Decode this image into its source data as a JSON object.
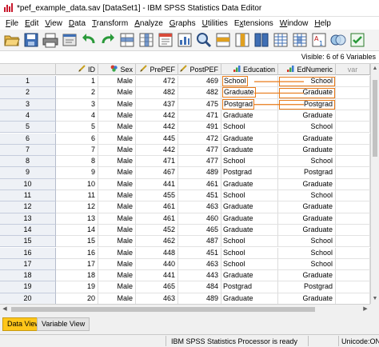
{
  "window": {
    "title": "*pef_example_data.sav [DataSet1] - IBM SPSS Statistics Data Editor"
  },
  "menu": [
    {
      "label": "File",
      "key": "F"
    },
    {
      "label": "Edit",
      "key": "E"
    },
    {
      "label": "View",
      "key": "V"
    },
    {
      "label": "Data",
      "key": "D"
    },
    {
      "label": "Transform",
      "key": "T"
    },
    {
      "label": "Analyze",
      "key": "A"
    },
    {
      "label": "Graphs",
      "key": "G"
    },
    {
      "label": "Utilities",
      "key": "U"
    },
    {
      "label": "Extensions",
      "key": "x"
    },
    {
      "label": "Window",
      "key": "W"
    },
    {
      "label": "Help",
      "key": "H"
    }
  ],
  "toolbar_icons": [
    "open-folder-icon",
    "save-icon",
    "print-icon",
    "dialog-recall-icon",
    "undo-icon",
    "redo-icon",
    "go-to-case-icon",
    "go-to-variable-icon",
    "variables-icon",
    "run-descriptives-icon",
    "find-icon",
    "insert-cases-icon",
    "insert-variable-icon",
    "split-file-icon",
    "weight-cases-icon",
    "select-cases-icon",
    "value-labels-icon",
    "use-variable-sets-icon",
    "spelling-icon"
  ],
  "info": {
    "visible": "Visible: 6 of 6 Variables"
  },
  "columns": [
    {
      "label": "ID",
      "kind": "scale",
      "align": "num"
    },
    {
      "label": "Sex",
      "kind": "nominal",
      "align": "num"
    },
    {
      "label": "PrePEF",
      "kind": "scale",
      "align": "num"
    },
    {
      "label": "PostPEF",
      "kind": "scale",
      "align": "num"
    },
    {
      "label": "Education",
      "kind": "ordinal",
      "align": "str"
    },
    {
      "label": "EdNumeric",
      "kind": "ordinal",
      "align": "rstr"
    },
    {
      "label": "var",
      "kind": "empty",
      "align": "var"
    }
  ],
  "rows": [
    {
      "n": "1",
      "cells": [
        "1",
        "Male",
        "472",
        "469",
        "School",
        "School"
      ]
    },
    {
      "n": "2",
      "cells": [
        "2",
        "Male",
        "482",
        "482",
        "Graduate",
        "Graduate"
      ]
    },
    {
      "n": "3",
      "cells": [
        "3",
        "Male",
        "437",
        "475",
        "Postgrad",
        "Postgrad"
      ]
    },
    {
      "n": "4",
      "cells": [
        "4",
        "Male",
        "442",
        "471",
        "Graduate",
        "Graduate"
      ]
    },
    {
      "n": "5",
      "cells": [
        "5",
        "Male",
        "442",
        "491",
        "School",
        "School"
      ]
    },
    {
      "n": "6",
      "cells": [
        "6",
        "Male",
        "445",
        "472",
        "Graduate",
        "Graduate"
      ]
    },
    {
      "n": "7",
      "cells": [
        "7",
        "Male",
        "442",
        "477",
        "Graduate",
        "Graduate"
      ]
    },
    {
      "n": "8",
      "cells": [
        "8",
        "Male",
        "471",
        "477",
        "School",
        "School"
      ]
    },
    {
      "n": "9",
      "cells": [
        "9",
        "Male",
        "467",
        "489",
        "Postgrad",
        "Postgrad"
      ]
    },
    {
      "n": "10",
      "cells": [
        "10",
        "Male",
        "441",
        "461",
        "Graduate",
        "Graduate"
      ]
    },
    {
      "n": "11",
      "cells": [
        "11",
        "Male",
        "455",
        "451",
        "School",
        "School"
      ]
    },
    {
      "n": "12",
      "cells": [
        "12",
        "Male",
        "461",
        "463",
        "Graduate",
        "Graduate"
      ]
    },
    {
      "n": "13",
      "cells": [
        "13",
        "Male",
        "461",
        "460",
        "Graduate",
        "Graduate"
      ]
    },
    {
      "n": "14",
      "cells": [
        "14",
        "Male",
        "452",
        "465",
        "Graduate",
        "Graduate"
      ]
    },
    {
      "n": "15",
      "cells": [
        "15",
        "Male",
        "462",
        "487",
        "School",
        "School"
      ]
    },
    {
      "n": "16",
      "cells": [
        "16",
        "Male",
        "448",
        "451",
        "School",
        "School"
      ]
    },
    {
      "n": "17",
      "cells": [
        "17",
        "Male",
        "440",
        "463",
        "School",
        "School"
      ]
    },
    {
      "n": "18",
      "cells": [
        "18",
        "Male",
        "441",
        "443",
        "Graduate",
        "Graduate"
      ]
    },
    {
      "n": "19",
      "cells": [
        "19",
        "Male",
        "465",
        "484",
        "Postgrad",
        "Postgrad"
      ]
    },
    {
      "n": "20",
      "cells": [
        "20",
        "Male",
        "463",
        "489",
        "Graduate",
        "Graduate"
      ]
    }
  ],
  "highlight_color": "#e87a18",
  "tabs": {
    "data_view": "Data View",
    "variable_view": "Variable View"
  },
  "status": {
    "processor": "IBM SPSS Statistics Processor is ready",
    "unicode": "Unicode:ON"
  }
}
